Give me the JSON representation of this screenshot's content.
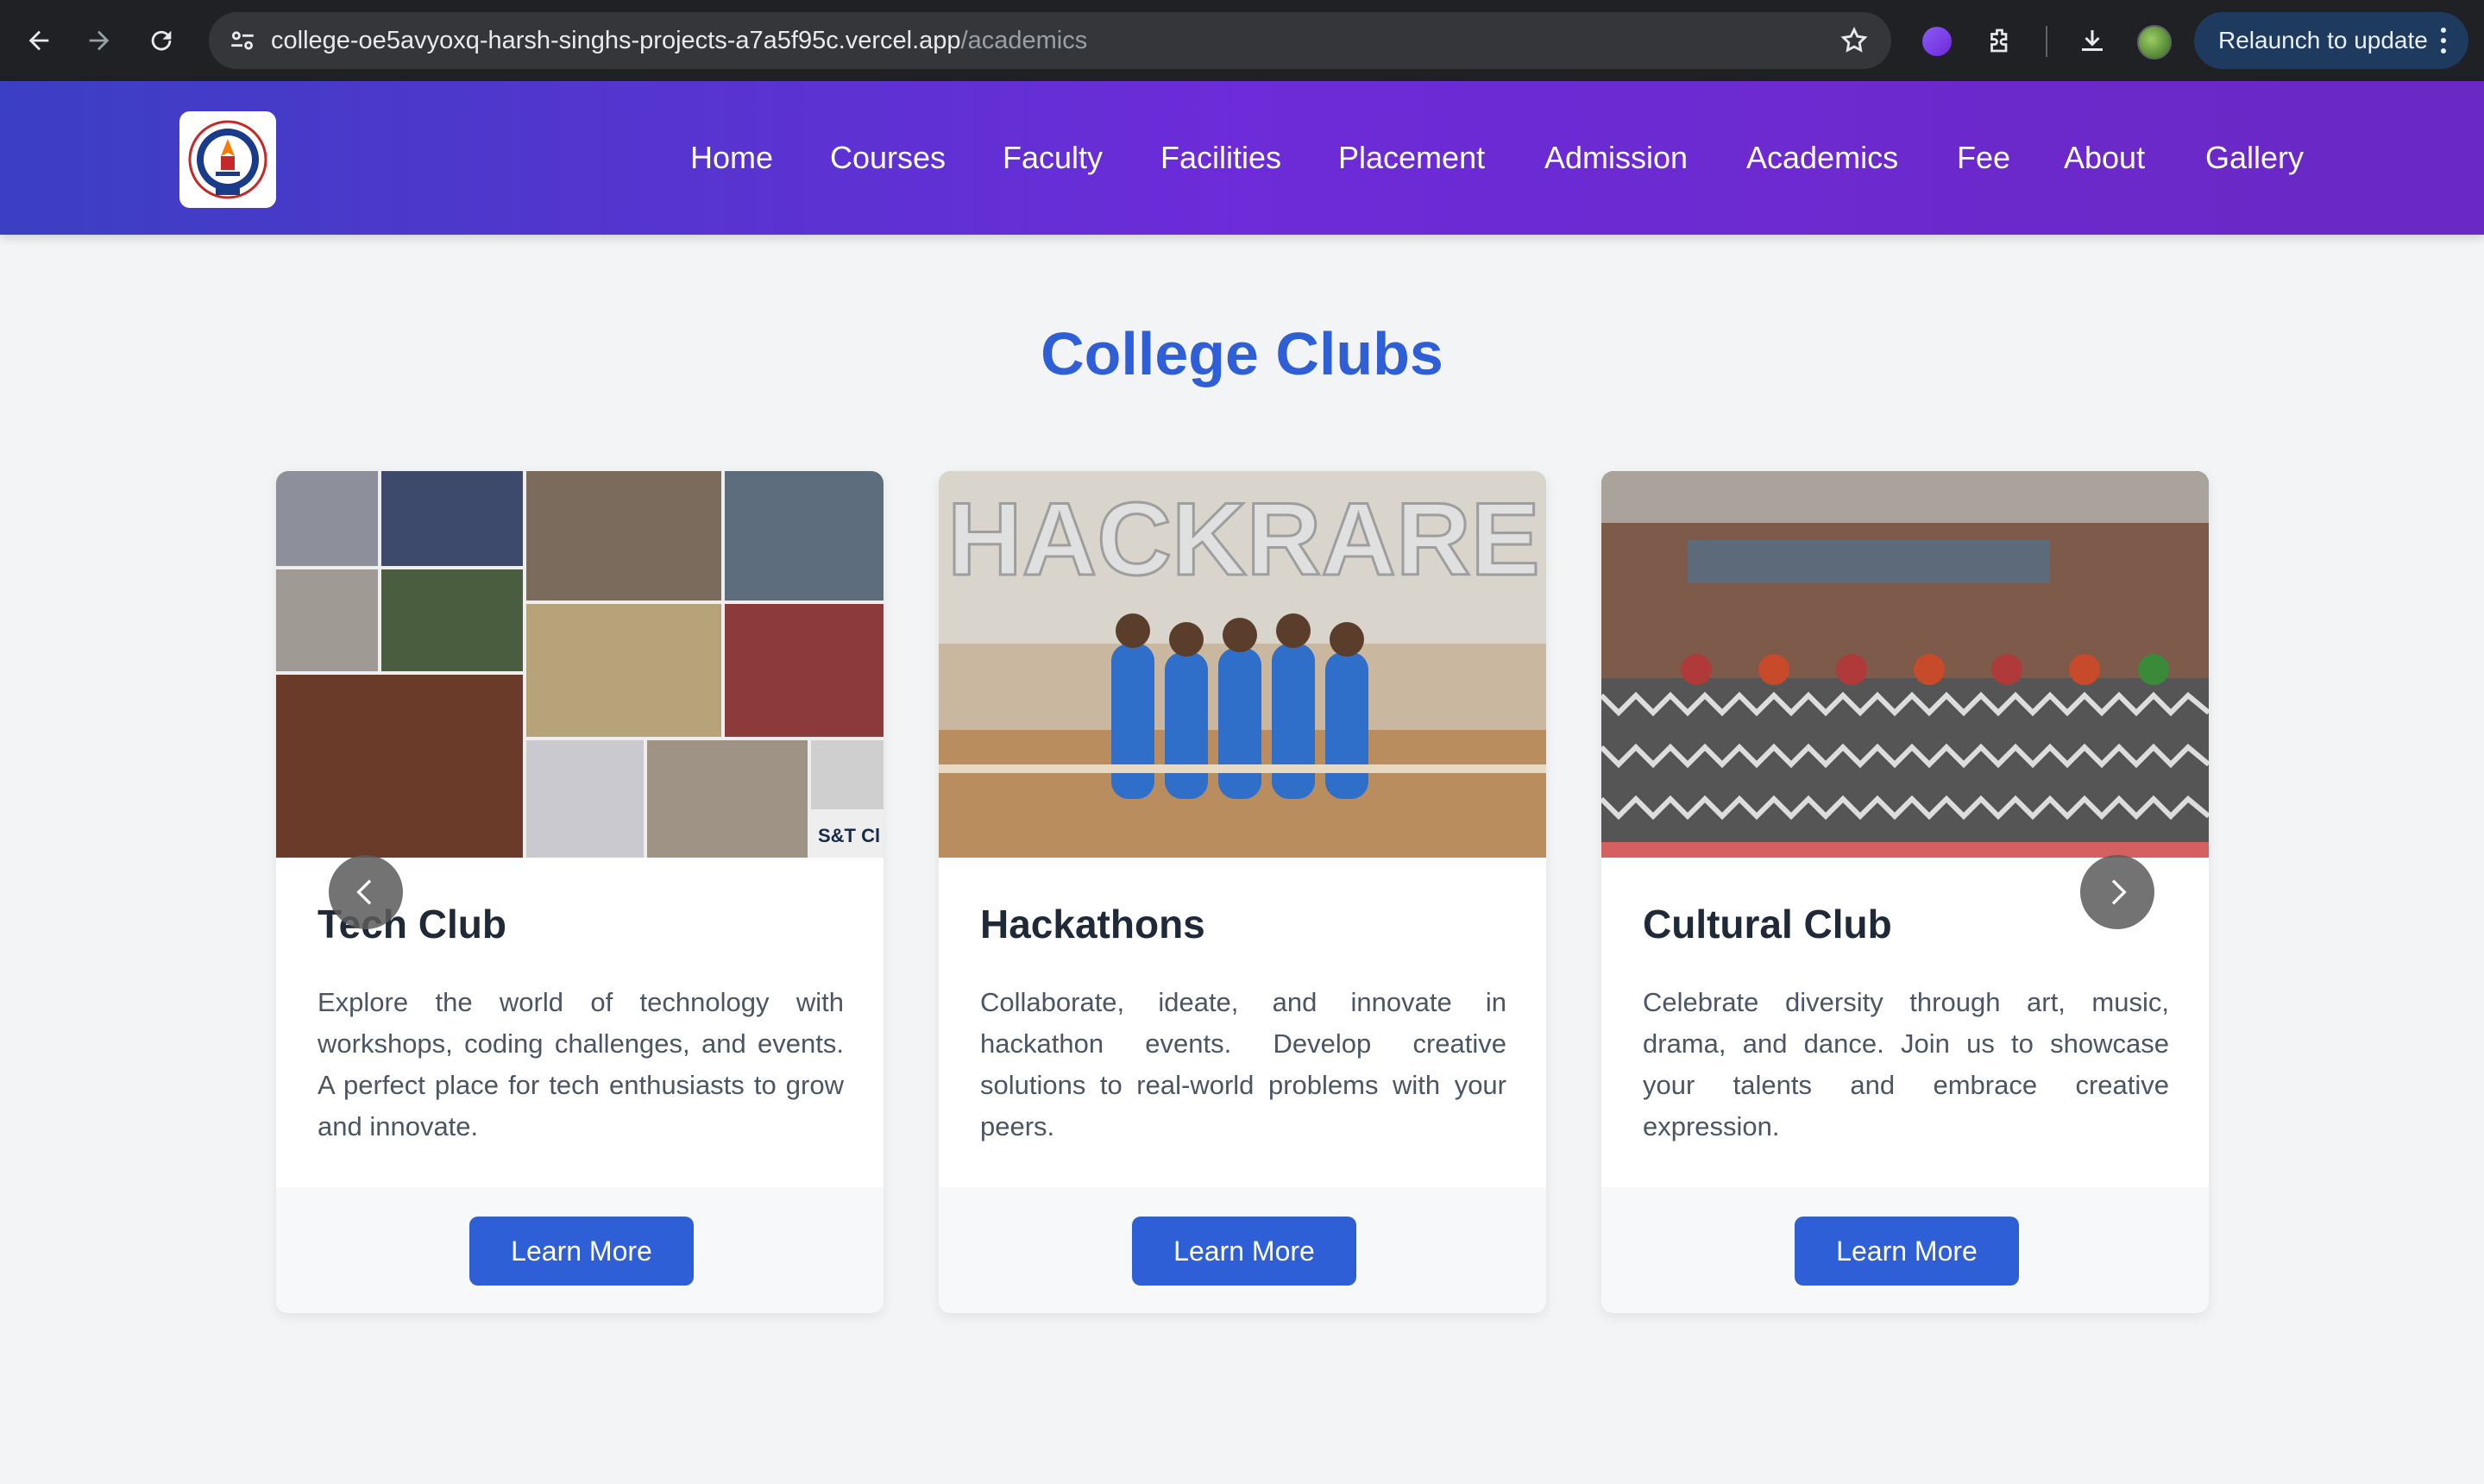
{
  "browser": {
    "url_host": "college-oe5avyoxq-harsh-singhs-projects-a7a5f95c.vercel.app",
    "url_path": "/academics",
    "relaunch_label": "Relaunch to update"
  },
  "nav": {
    "items": [
      {
        "label": "Home"
      },
      {
        "label": "Courses"
      },
      {
        "label": "Faculty"
      },
      {
        "label": "Facilities"
      },
      {
        "label": "Placement"
      },
      {
        "label": "Admission"
      },
      {
        "label": "Academics"
      },
      {
        "label": "Fee"
      },
      {
        "label": "About"
      },
      {
        "label": "Gallery"
      }
    ]
  },
  "section": {
    "title": "College Clubs"
  },
  "clubs": [
    {
      "title": "Tech Club",
      "description": "Explore the world of technology with workshops, coding challenges, and events. A perfect place for tech enthusiasts to grow and innovate.",
      "button": "Learn More",
      "photo_caption": "S&T Cl"
    },
    {
      "title": "Hackathons",
      "description": "Collaborate, ideate, and innovate in hackathon events. Develop creative solutions to real-world problems with your peers.",
      "button": "Learn More",
      "photo_caption": "HACKRARE"
    },
    {
      "title": "Cultural Club",
      "description": "Celebrate diversity through art, music, drama, and dance. Join us to showcase your talents and embrace creative expression.",
      "button": "Learn More",
      "photo_caption": ""
    }
  ],
  "colors": {
    "accent": "#2f5fd6",
    "header_start": "#3b3fc4",
    "header_end": "#6a28c4"
  }
}
